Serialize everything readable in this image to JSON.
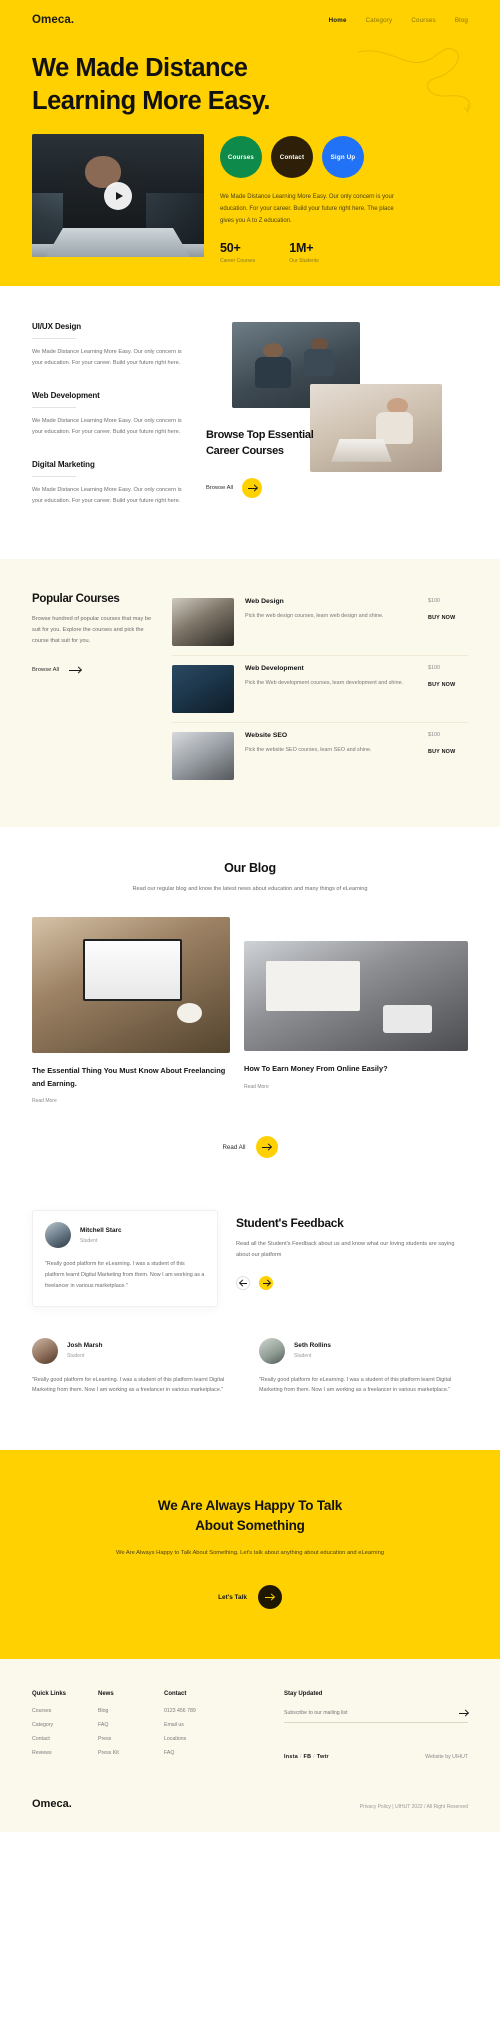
{
  "brand": {
    "name": "Omeca."
  },
  "nav": {
    "items": [
      {
        "label": "Home",
        "active": true
      },
      {
        "label": "Category",
        "active": false
      },
      {
        "label": "Courses",
        "active": false
      },
      {
        "label": "Blog",
        "active": false
      }
    ]
  },
  "hero": {
    "title_line1": "We Made Distance",
    "title_line2": "Learning More Easy.",
    "play_icon": "play-icon",
    "buttons": [
      {
        "label": "Courses",
        "color": "#0E8A4A"
      },
      {
        "label": "Contact",
        "color": "#2E2008"
      },
      {
        "label": "Sign Up",
        "color": "#2272F7"
      }
    ],
    "description": "We Made Distance Learning More Easy. Our only concern is your education. For your career. Build your future right here. The place gives you A to Z education.",
    "stats": [
      {
        "value": "50+",
        "label": "Career Courses"
      },
      {
        "value": "1M+",
        "label": "Our Students"
      }
    ]
  },
  "categories": {
    "items": [
      {
        "title": "UI/UX Design",
        "desc": "We Made Distance Learning More Easy. Our only concern is your education. For your career. Build your future right here."
      },
      {
        "title": "Web Development",
        "desc": "We Made Distance Learning More Easy. Our only concern is your education. For your career. Build your future right here."
      },
      {
        "title": "Digital Marketing",
        "desc": "We Made Distance Learning More Easy. Our only concern is your education. For your career. Build your future right here."
      }
    ],
    "browse_title_line1": "Browse Top Essential",
    "browse_title_line2": "Career Courses",
    "browse_cta": "Browse All"
  },
  "popular": {
    "title": "Popular Courses",
    "desc": "Browse hundred of popular courses that may be suit for you. Explore the courses and pick the course that suit for you.",
    "cta": "Browse All",
    "courses": [
      {
        "name": "Web Design",
        "desc": "Pick the web design courses, learn web design and shine.",
        "price": "$100",
        "buy": "BUY NOW"
      },
      {
        "name": "Web Development",
        "desc": "Pick the Web development courses, learn development and shine.",
        "price": "$100",
        "buy": "BUY NOW"
      },
      {
        "name": "Website SEO",
        "desc": "Pick the website SEO courses, learn SEO and shine.",
        "price": "$100",
        "buy": "BUY NOW"
      }
    ]
  },
  "blog": {
    "title": "Our Blog",
    "subtitle": "Read our regular blog and know the latest news about education and many things of eLearning",
    "posts": [
      {
        "title": "The Essential Thing You Must Know About Freelancing and Earning.",
        "more": "Read More"
      },
      {
        "title": "How To Earn Money From Online Easily?",
        "more": "Read More"
      }
    ],
    "cta": "Read All"
  },
  "feedback": {
    "title": "Student's Feedback",
    "subtitle": "Read all the Student's Feedback about us and know what our loving students are saying about our platform",
    "prev_icon": "arrow-left-icon",
    "next_icon": "arrow-right-icon",
    "testimonials": [
      {
        "name": "Mitchell Starc",
        "role": "Student",
        "quote": "\"Really good platform for eLearning. I was a student of this platform learnt Digital Marketing from them. Now I am working as a freelancer in various marketplace.\""
      },
      {
        "name": "Josh Marsh",
        "role": "Student",
        "quote": "\"Really good platform for eLearning. I was a student of this platform learnt Digital Marketing from them. Now I am working as a freelancer in various marketplace.\""
      },
      {
        "name": "Seth Rollins",
        "role": "Student",
        "quote": "\"Really good platform for eLearning. I was a student of this platform learnt Digital Marketing from them. Now I am working as a freelancer in various marketplace.\""
      }
    ]
  },
  "cta_banner": {
    "title_line1": "We Are Always Happy To Talk",
    "title_line2": "About Something",
    "subtitle": "We Are Always Happy to Talk About Something. Let's talk about anything about education and eLearning",
    "button": "Let's Talk"
  },
  "footer": {
    "columns": [
      {
        "head": "Quick Links",
        "links": [
          "Courses",
          "Category",
          "Contact",
          "Reviews"
        ]
      },
      {
        "head": "News",
        "links": [
          "Blog",
          "FAQ",
          "Press",
          "Press Kit"
        ]
      },
      {
        "head": "Contact",
        "links": [
          "0123 456 789",
          "Email us",
          "Locations",
          "FAQ"
        ]
      }
    ],
    "subscribe_head": "Stay Updated",
    "subscribe_placeholder": "Subscribe to our mailing list",
    "subscribe_icon": "arrow-right-icon",
    "social": [
      "Insta",
      "FB",
      "Twtr"
    ],
    "byline": "Website by UIHUT",
    "logo": "Omeca.",
    "legal": "Privacy Policy  |  UIHUT 2022 / All Right Reserved"
  },
  "colors": {
    "accent": "#FFD100",
    "cream": "#FBF8EC",
    "dark": "#201700"
  }
}
